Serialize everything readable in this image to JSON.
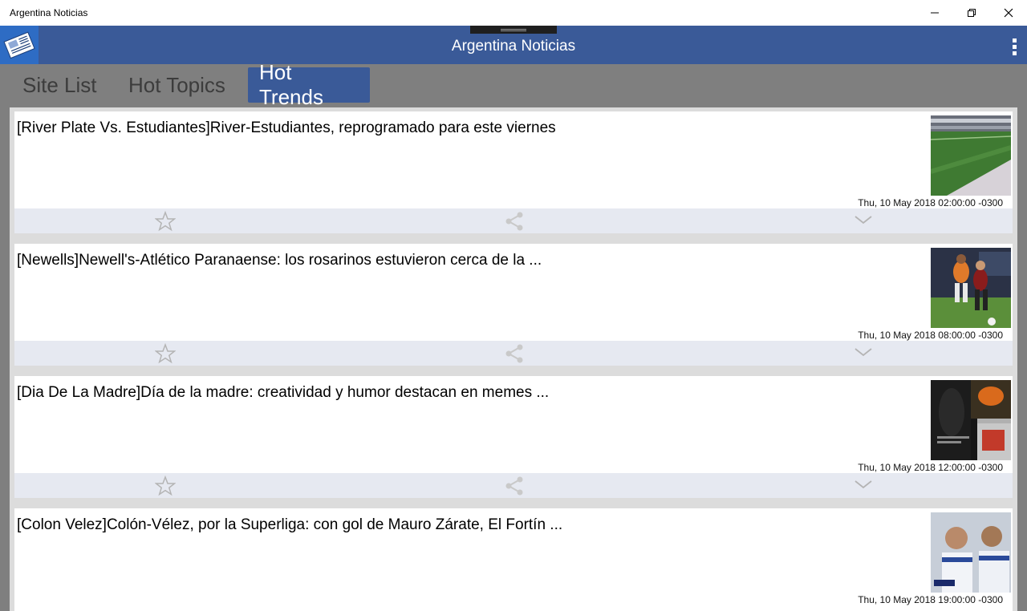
{
  "window": {
    "title": "Argentina Noticias",
    "controls": [
      "minimize-icon",
      "restore-icon",
      "close-icon"
    ]
  },
  "header": {
    "title": "Argentina Noticias",
    "accent_color": "#3a5a98",
    "logo_icon": "newspaper-icon",
    "menu_icon": "more-vertical-icon"
  },
  "tabs": [
    {
      "label": "Site List",
      "active": false
    },
    {
      "label": "Hot Topics",
      "active": false
    },
    {
      "label": "Hot Trends",
      "active": true
    }
  ],
  "articles": [
    {
      "headline": "[River Plate Vs. Estudiantes]River-Estudiantes, reprogramado para este viernes",
      "date": "Thu, 10 May 2018 02:00:00 -0300",
      "thumbnail": "stadium-photo"
    },
    {
      "headline": "[Newells]Newell's-Atlético Paranaense: los rosarinos estuvieron cerca de la ...",
      "date": "Thu, 10 May 2018 08:00:00 -0300",
      "thumbnail": "football-match-photo"
    },
    {
      "headline": "[Dia De La Madre]Día de la madre: creatividad y humor destacan en memes ...",
      "date": "Thu, 10 May 2018 12:00:00 -0300",
      "thumbnail": "meme-collage-photo"
    },
    {
      "headline": "[Colon Velez]Colón-Vélez, por la Superliga: con gol de Mauro Zárate, El Fortín ...",
      "date": "Thu, 10 May 2018 19:00:00 -0300",
      "thumbnail": "players-celebrating-photo"
    }
  ],
  "actions": {
    "favorite_icon": "star-icon",
    "share_icon": "share-icon",
    "expand_icon": "chevron-down-icon"
  }
}
